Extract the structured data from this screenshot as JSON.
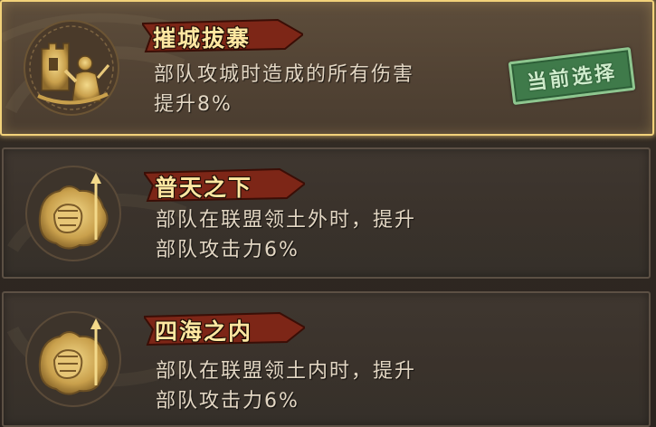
{
  "options": [
    {
      "title": "摧城拔寨",
      "desc_lines": [
        "部队攻城时造成的所有伤害",
        "提升8%"
      ],
      "icon": "castle-siege-emblem-icon",
      "selected": true
    },
    {
      "title": "普天之下",
      "desc_lines": [
        "部队在联盟领土外时，提升",
        "部队攻击力6%"
      ],
      "icon": "fist-emblem-icon",
      "selected": false
    },
    {
      "title": "四海之内",
      "desc_lines": [
        "部队在联盟领土内时，提升",
        "部队攻击力6%"
      ],
      "icon": "fist-emblem-icon",
      "selected": false
    }
  ],
  "current_selection_label": "当前选择",
  "colors": {
    "selected_border": "#f2d27a",
    "title_text": "#ffe7a1",
    "banner_red": "#8a2a1a",
    "stamp_green": "#3f7a4a",
    "emblem_gold": "#d9b55f"
  }
}
